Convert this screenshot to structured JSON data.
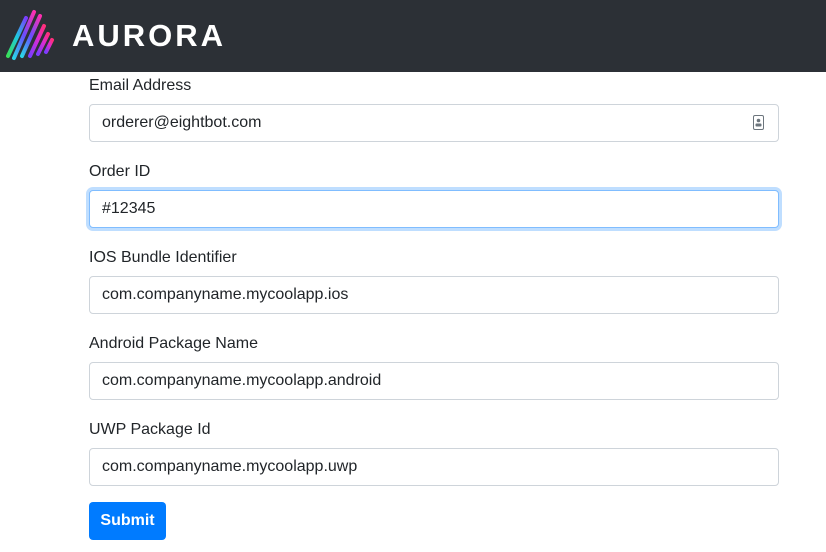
{
  "header": {
    "brand": "AURORA",
    "logo_icon": "aurora-streaks-icon"
  },
  "form": {
    "fields": [
      {
        "label": "Email Address",
        "value": "orderer@eightbot.com",
        "icon": "contact-card-icon"
      },
      {
        "label": "Order ID",
        "value": "#12345",
        "focused": true
      },
      {
        "label": "IOS Bundle Identifier",
        "value": "com.companyname.mycoolapp.ios"
      },
      {
        "label": "Android Package Name",
        "value": "com.companyname.mycoolapp.android"
      },
      {
        "label": "UWP Package Id",
        "value": "com.companyname.mycoolapp.uwp"
      }
    ],
    "submit_label": "Submit"
  },
  "colors": {
    "navbar": "#2c3036",
    "primary": "#007bff",
    "focus_border": "#80bdff"
  }
}
